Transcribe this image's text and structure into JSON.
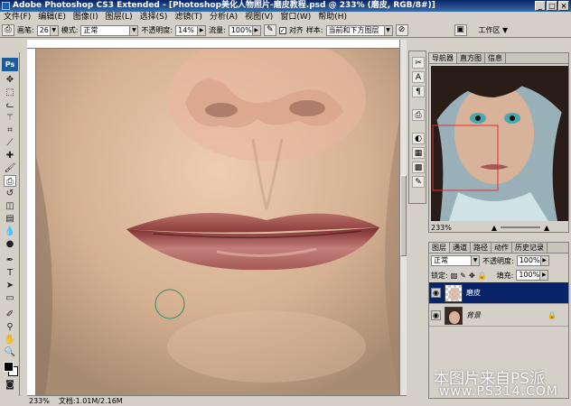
{
  "window": {
    "title": "Adobe Photoshop CS3 Extended - [Photoshop美化人物照片-磨皮教程.psd @ 233% (磨皮, RGB/8#)]",
    "buttons": [
      "_",
      "□",
      "×"
    ]
  },
  "menu": [
    "文件(F)",
    "编辑(E)",
    "图像(I)",
    "图层(L)",
    "选择(S)",
    "滤镜(T)",
    "分析(A)",
    "视图(V)",
    "窗口(W)",
    "帮助(H)"
  ],
  "options": {
    "brush_label": "画笔:",
    "brush_size": "26",
    "mode_label": "模式:",
    "mode_value": "正常",
    "opacity_label": "不透明度:",
    "opacity_value": "14%",
    "flow_label": "流量:",
    "flow_value": "100%",
    "aligned_label": "对齐",
    "sample_label": "样本:",
    "sample_value": "当前和下方图层",
    "workspace_label": "工作区 ▼"
  },
  "status": {
    "zoom": "233%",
    "doc": "文档:1.01M/2.16M"
  },
  "navigator": {
    "tabs": [
      "导航器",
      "直方图",
      "信息"
    ],
    "zoom": "233%"
  },
  "layers": {
    "tabs": [
      "图层",
      "通道",
      "路径",
      "动作",
      "历史记录"
    ],
    "blend_mode": "正常",
    "opacity_label": "不透明度:",
    "opacity_value": "100%",
    "lock_label": "锁定:",
    "fill_label": "填充:",
    "fill_value": "100%",
    "items": [
      {
        "name": "磨皮",
        "selected": true
      },
      {
        "name": "背景",
        "selected": false
      }
    ]
  },
  "watermark": {
    "line1": "本图片来自PS派",
    "line2": "www.PS314.COM"
  },
  "colors": {
    "title_bar": "#0a246a",
    "selected_layer": "#0a246a",
    "navigator_box": "#e03030"
  }
}
